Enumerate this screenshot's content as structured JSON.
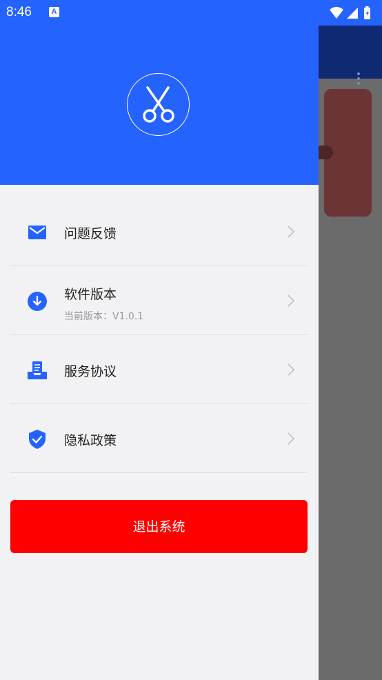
{
  "status_bar": {
    "time": "8:46",
    "notification_badge": "A"
  },
  "drawer": {
    "menu": [
      {
        "label": "问题反馈",
        "icon": "mail-icon"
      },
      {
        "label": "软件版本",
        "sub": "当前版本：V1.0.1",
        "icon": "download-icon"
      },
      {
        "label": "服务协议",
        "icon": "document-tray-icon"
      },
      {
        "label": "隐私政策",
        "icon": "shield-check-icon"
      }
    ],
    "logout_label": "退出系统"
  },
  "colors": {
    "accent": "#2563ff",
    "danger": "#ff0000",
    "drawer_bg": "#f2f2f4"
  }
}
